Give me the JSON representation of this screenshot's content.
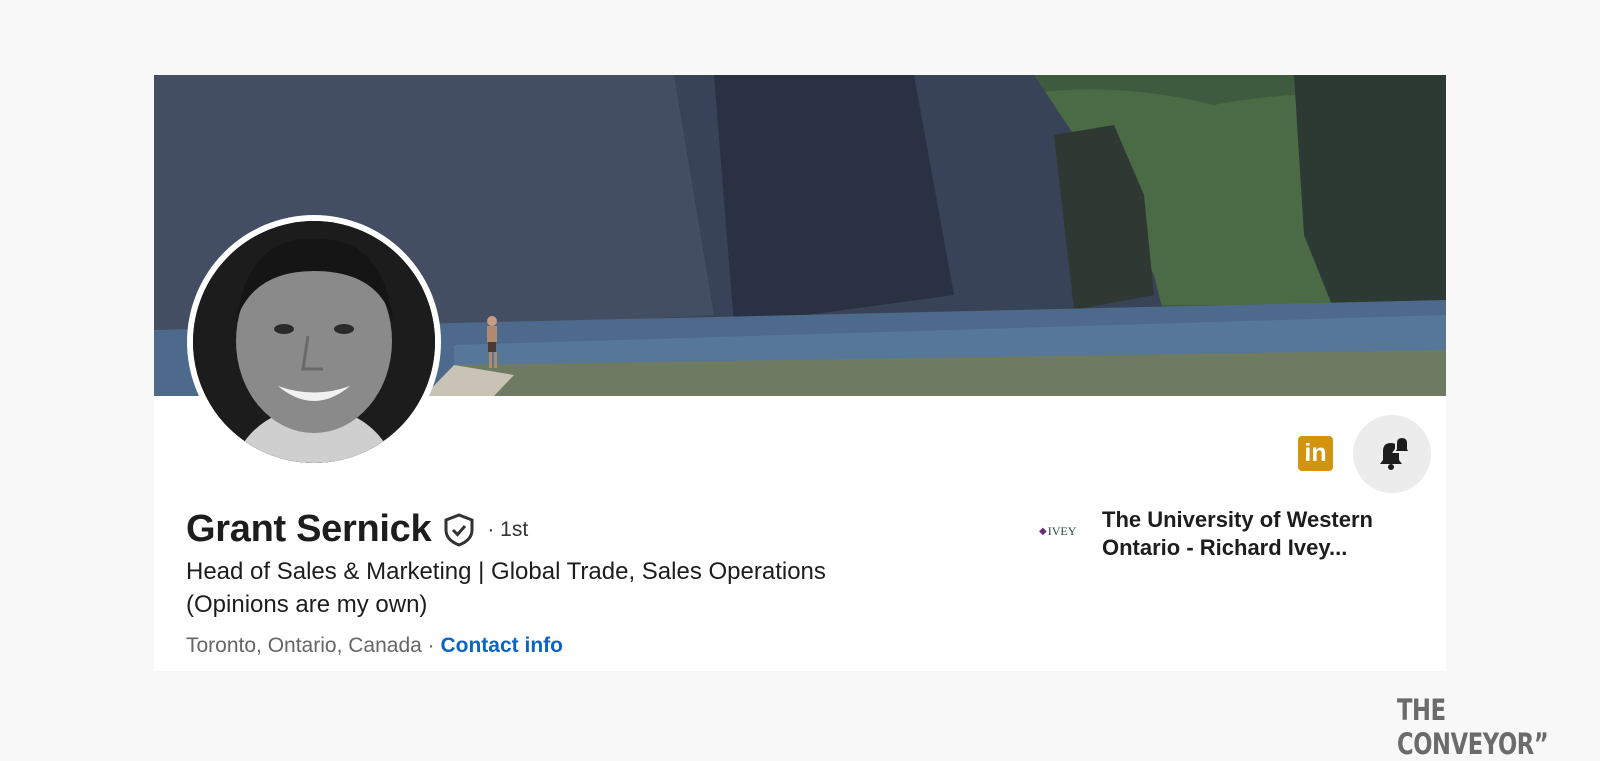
{
  "profile": {
    "name": "Grant Sernick",
    "degree": "· 1st",
    "headline": "Head of Sales & Marketing | Global Trade, Sales Operations (Opinions are my own)",
    "location": "Toronto, Ontario, Canada",
    "separator": " · ",
    "contact_label": "Contact info"
  },
  "education": {
    "logo_text": "IVEY",
    "school_name": "The University of Western Ontario - Richard Ivey..."
  },
  "actions": {
    "linkedin_label": "in"
  },
  "brand": {
    "label": "THE CONVEYOR”"
  },
  "icons": {
    "verified": "shield-check-icon",
    "linkedin": "linkedin-icon",
    "bell": "bell-notification-icon",
    "school_logo": "school-logo-icon"
  },
  "colors": {
    "link": "#0a66c2",
    "linkedin_button": "#d4930e",
    "page_background": "#f8f8f8"
  }
}
